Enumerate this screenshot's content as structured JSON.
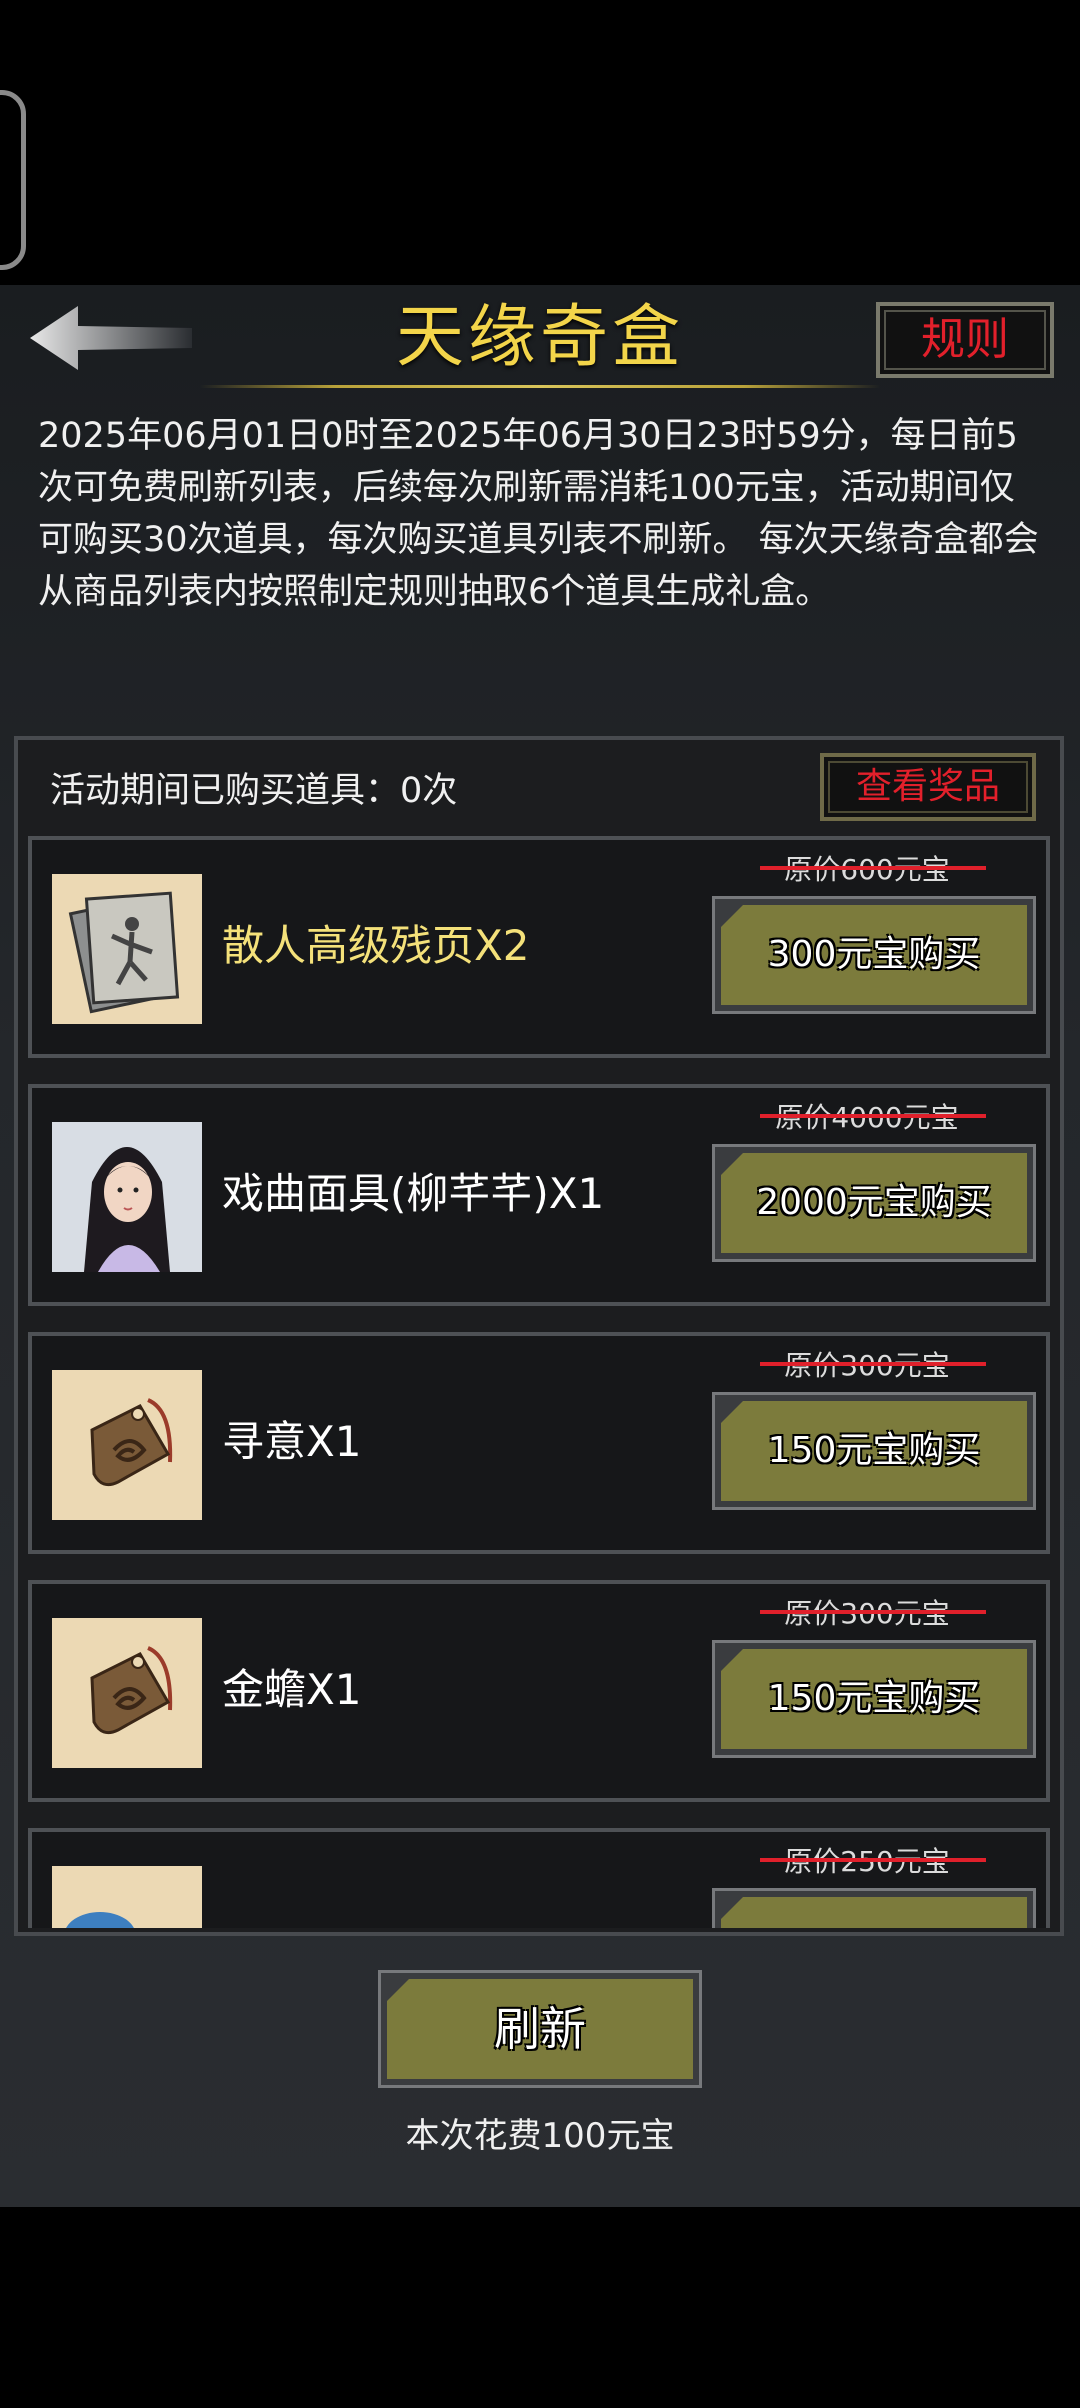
{
  "header": {
    "title": "天缘奇盒",
    "rules_label": "规则"
  },
  "description": "2025年06月01日0时至2025年06月30日23时59分，每日前5次可免费刷新列表，后续每次刷新需消耗100元宝，活动期间仅可购买30次道具，每次购买道具列表不刷新。 每次天缘奇盒都会从商品列表内按照制定规则抽取6个道具生成礼盒。",
  "list": {
    "count_label": "活动期间已购买道具：0次",
    "view_rewards_label": "查看奖品",
    "items": [
      {
        "name": "散人高级残页X2",
        "original_price": "原价600元宝",
        "buy_label": "300元宝购买",
        "icon": "scroll-pages-icon"
      },
      {
        "name": "戏曲面具(柳芊芊)X1",
        "original_price": "原价4000元宝",
        "buy_label": "2000元宝购买",
        "icon": "character-portrait-icon"
      },
      {
        "name": "寻意X1",
        "original_price": "原价300元宝",
        "buy_label": "150元宝购买",
        "icon": "jade-pendant-icon"
      },
      {
        "name": "金蟾X1",
        "original_price": "原价300元宝",
        "buy_label": "150元宝购买",
        "icon": "jade-pendant-icon"
      },
      {
        "name": "",
        "original_price": "原价250元宝",
        "buy_label": "",
        "icon": "blue-item-icon"
      }
    ]
  },
  "footer": {
    "refresh_label": "刷新",
    "cost_label": "本次花费100元宝"
  },
  "colors": {
    "title_gold": "#f3d54a",
    "rules_red": "#e2202b",
    "button_olive": "#7c7b3c",
    "highlight_name": "#f4e17a"
  }
}
